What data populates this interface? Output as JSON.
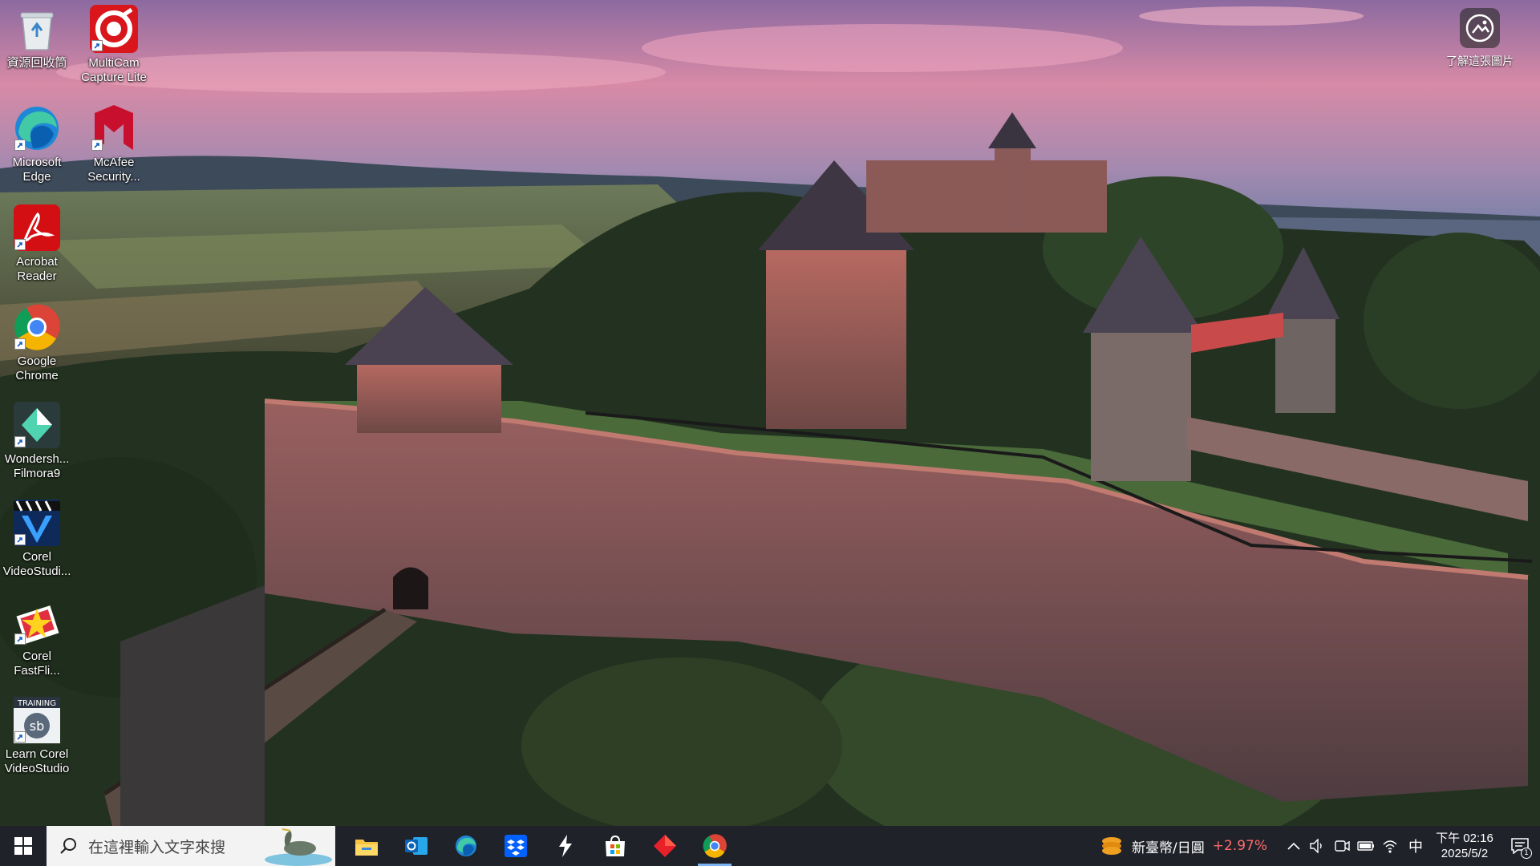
{
  "wallpaper": {
    "description_icon": "castle-landscape"
  },
  "desktop": {
    "icons": [
      {
        "label": "資源回收筒",
        "icon": "recycle-bin-icon"
      },
      {
        "label": "MultiCam\nCapture Lite",
        "icon": "multicam-icon"
      },
      {
        "label": "Microsoft\nEdge",
        "icon": "edge-icon"
      },
      {
        "label": "McAfee\nSecurity...",
        "icon": "mcafee-icon"
      },
      {
        "label": "Acrobat\nReader",
        "icon": "acrobat-icon"
      },
      {
        "label": "Google\nChrome",
        "icon": "chrome-icon"
      },
      {
        "label": "Wondersh...\nFilmora9",
        "icon": "filmora-icon"
      },
      {
        "label": "Corel\nVideoStudi...",
        "icon": "videostudio-icon"
      },
      {
        "label": "Corel\nFastFli...",
        "icon": "fastflick-icon"
      },
      {
        "label": "Learn Corel\nVideoStudio",
        "icon": "training-icon"
      }
    ]
  },
  "spotlight": {
    "label": "了解這張圖片"
  },
  "taskbar": {
    "search_placeholder": "在這裡輸入文字來搜",
    "apps": [
      {
        "name": "file-explorer-icon"
      },
      {
        "name": "outlook-icon"
      },
      {
        "name": "edge-icon"
      },
      {
        "name": "dropbox-icon"
      },
      {
        "name": "app-bolt-icon"
      },
      {
        "name": "microsoft-store-icon"
      },
      {
        "name": "red-diamond-app-icon"
      },
      {
        "name": "chrome-icon",
        "active": true
      }
    ],
    "stock": {
      "name": "新臺幣/日圓",
      "change": "+2.97%"
    },
    "ime": "中",
    "clock": {
      "time": "下午 02:16",
      "date": "2025/5/2"
    },
    "notifications_count": "1"
  },
  "colors": {
    "taskbar_bg": "#20222a",
    "stock_change": "#ff6b6b",
    "active_indicator": "#7db3f0"
  }
}
